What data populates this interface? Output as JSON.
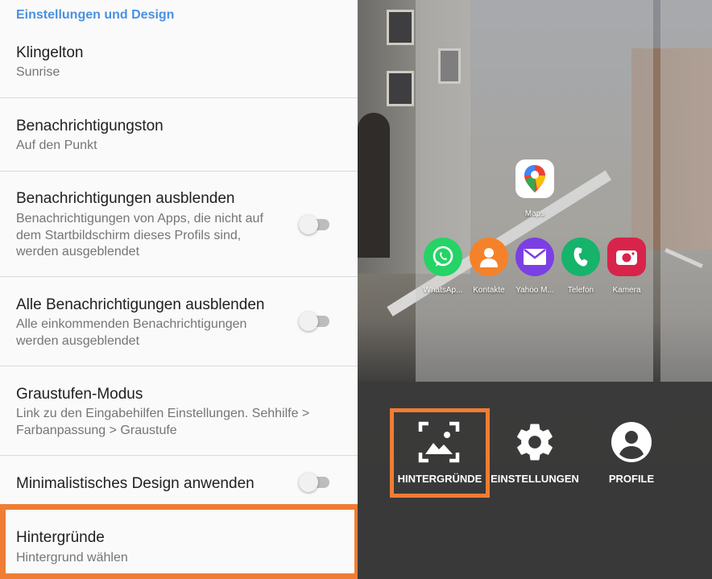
{
  "accent_color": "#4a90e2",
  "highlight_color": "#ef7d33",
  "settings": {
    "section_header": "Einstellungen und Design",
    "items": [
      {
        "title": "Klingelton",
        "subtitle": "Sunrise"
      },
      {
        "title": "Benachrichtigungston",
        "subtitle": "Auf den Punkt"
      },
      {
        "title": "Benachrichtigungen ausblenden",
        "subtitle": "Benachrichtigungen von Apps, die nicht auf dem Startbildschirm dieses Profils sind, werden ausgeblendet",
        "toggle": "off"
      },
      {
        "title": "Alle Benachrichtigungen ausblenden",
        "subtitle": "Alle einkommenden Benachrichtigungen werden ausgeblendet",
        "toggle": "off"
      },
      {
        "title": "Graustufen-Modus",
        "subtitle": "Link zu den Eingabehilfen Einstellungen. Sehhilfe > Farbanpassung > Graustufe"
      },
      {
        "title": "Minimalistisches Design anwenden",
        "toggle": "off"
      },
      {
        "title": "Hintergründe",
        "subtitle": "Hintergrund wählen"
      }
    ]
  },
  "preview": {
    "apps": [
      {
        "label": "Maps",
        "icon": "maps-icon"
      },
      {
        "label": "WhatsAp...",
        "icon": "whatsapp-icon",
        "color": "#25d366"
      },
      {
        "label": "Kontakte",
        "icon": "contacts-icon",
        "color": "#f5822a"
      },
      {
        "label": "Yahoo M...",
        "icon": "mail-icon",
        "color": "#7b3fe4"
      },
      {
        "label": "Telefon",
        "icon": "phone-icon",
        "color": "#16b36b"
      },
      {
        "label": "Kamera",
        "icon": "camera-icon",
        "color": "#d8244a"
      }
    ],
    "actions": [
      {
        "label": "HINTERGRÜNDE",
        "icon": "wallpaper-icon"
      },
      {
        "label": "EINSTELLUNGEN",
        "icon": "gear-icon"
      },
      {
        "label": "PROFILE",
        "icon": "profile-icon"
      }
    ]
  }
}
